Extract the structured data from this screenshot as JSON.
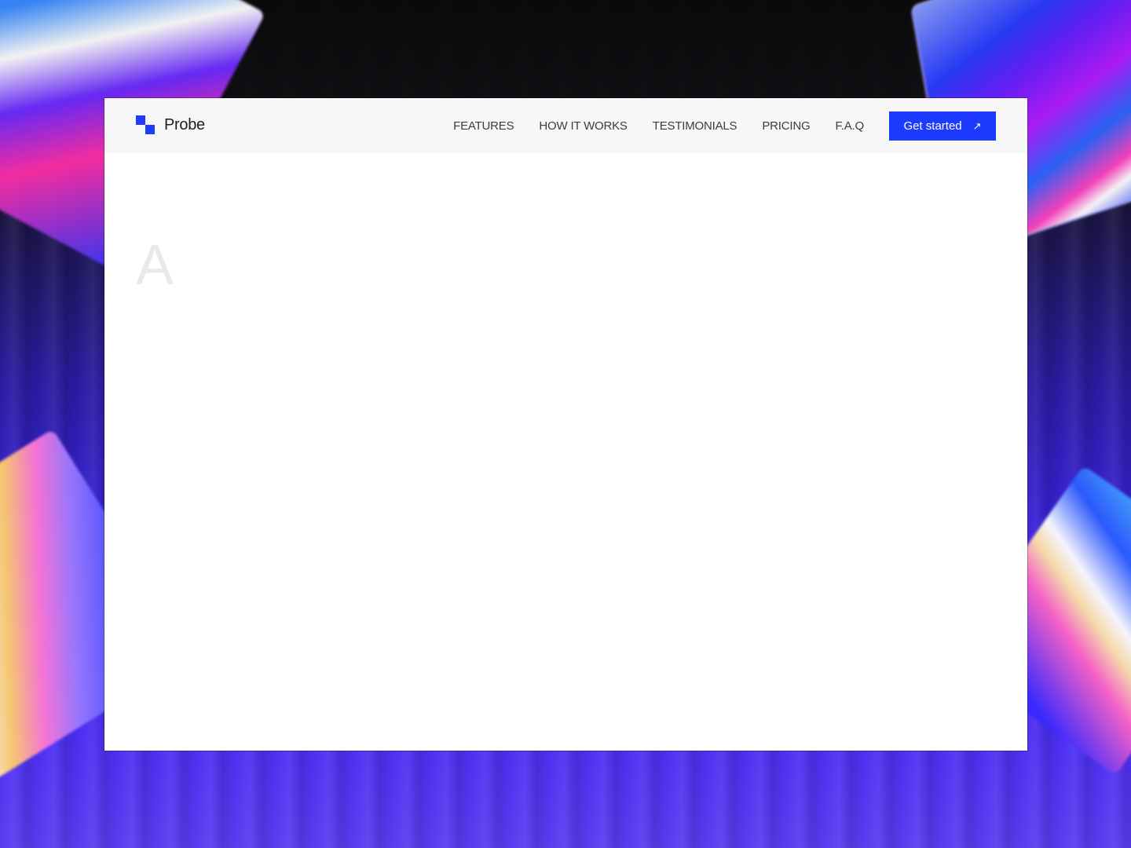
{
  "brand": {
    "name": "Probe",
    "logo_color": "#1c3bff"
  },
  "nav": {
    "links": [
      "FEATURES",
      "HOW IT WORKS",
      "TESTIMONIALS",
      "PRICING",
      "F.A.Q"
    ]
  },
  "cta": {
    "label": "Get started",
    "icon": "arrow-up-right-icon",
    "color": "#1c3bff"
  },
  "hero": {
    "partial_text": "A"
  },
  "colors": {
    "navbar_bg": "#f7f7f7",
    "page_bg": "#ffffff",
    "accent": "#1c3bff"
  }
}
